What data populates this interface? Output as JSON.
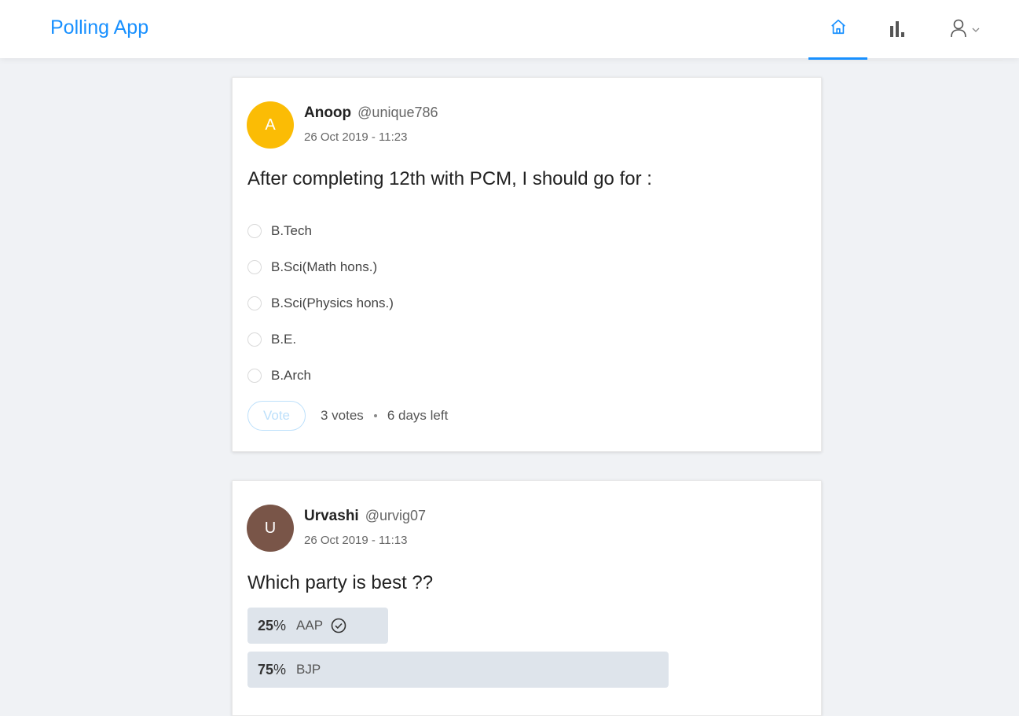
{
  "app": {
    "title": "Polling App"
  },
  "nav": {
    "items": [
      {
        "name": "home",
        "icon": "home-icon",
        "active": true
      },
      {
        "name": "new-poll",
        "icon": "bar-chart-icon",
        "active": false
      },
      {
        "name": "profile",
        "icon": "user-icon",
        "active": false
      }
    ]
  },
  "polls": [
    {
      "avatar_letter": "A",
      "avatar_color": "#fbbc05",
      "author_name": "Anoop",
      "author_handle": "@unique786",
      "date": "26 Oct 2019 - 11:23",
      "question": "After completing 12th with PCM, I should go for :",
      "choices": [
        {
          "label": "B.Tech"
        },
        {
          "label": "B.Sci(Math hons.)"
        },
        {
          "label": "B.Sci(Physics hons.)"
        },
        {
          "label": "B.E."
        },
        {
          "label": "B.Arch"
        }
      ],
      "vote_label": "Vote",
      "votes_text": "3 votes",
      "time_left": "6 days left"
    },
    {
      "avatar_letter": "U",
      "avatar_color": "#795548",
      "author_name": "Urvashi",
      "author_handle": "@urvig07",
      "date": "26 Oct 2019 - 11:13",
      "question": "Which party is best ??",
      "results": [
        {
          "percent": 25,
          "percent_text": "25",
          "label": "AAP",
          "selected": true
        },
        {
          "percent": 75,
          "percent_text": "75",
          "label": "BJP",
          "selected": false
        }
      ]
    }
  ]
}
